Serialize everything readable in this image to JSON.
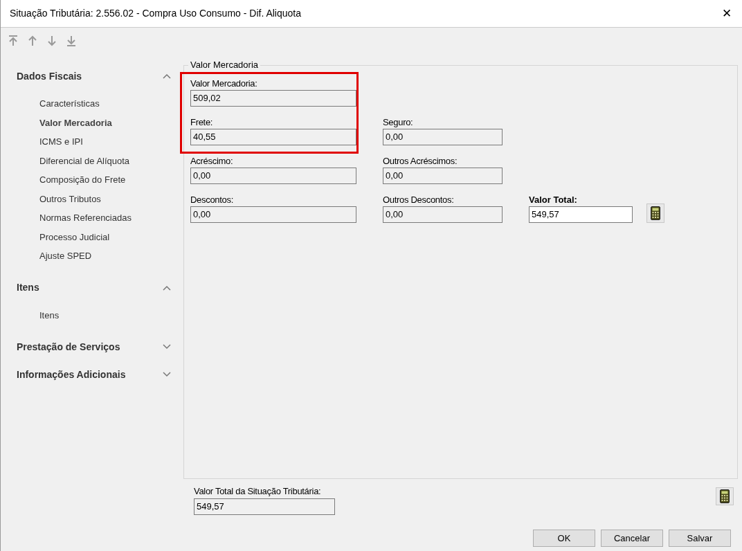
{
  "window": {
    "title": "Situação Tributária: 2.556.02 - Compra Uso Consumo - Dif. Aliquota",
    "close": "✕"
  },
  "toolbar": [
    {
      "kind": "first"
    },
    {
      "kind": "up"
    },
    {
      "kind": "down"
    },
    {
      "kind": "last"
    }
  ],
  "sidebar": {
    "sections": [
      {
        "title": "Dados Fiscais",
        "expanded": true,
        "items": [
          {
            "label": "Características",
            "selected": false
          },
          {
            "label": "Valor Mercadoria",
            "selected": true
          },
          {
            "label": "ICMS e IPI",
            "selected": false
          },
          {
            "label": "Diferencial de Alíquota",
            "selected": false
          },
          {
            "label": "Composição do Frete",
            "selected": false
          },
          {
            "label": "Outros Tributos",
            "selected": false
          },
          {
            "label": "Normas Referenciadas",
            "selected": false
          },
          {
            "label": "Processo Judicial",
            "selected": false
          },
          {
            "label": "Ajuste SPED",
            "selected": false
          }
        ]
      },
      {
        "title": "Itens",
        "expanded": true,
        "items": [
          {
            "label": "Itens",
            "selected": false
          }
        ]
      },
      {
        "title": "Prestação de Serviços",
        "expanded": false
      },
      {
        "title": "Informações Adicionais",
        "expanded": false
      }
    ]
  },
  "group": {
    "title": "Valor Mercadoria",
    "rows": [
      [
        {
          "label": "Valor Mercadoria:",
          "value": "509,02",
          "highlighted": true
        }
      ],
      [
        {
          "label": "Frete:",
          "value": "40,55",
          "highlighted": true
        },
        {
          "label": "Seguro:",
          "value": "0,00",
          "highlighted": false
        }
      ],
      [
        {
          "label": "Acréscimo:",
          "value": "0,00",
          "highlighted": false
        },
        {
          "label": "Outros Acréscimos:",
          "value": "0,00",
          "highlighted": false
        }
      ],
      [
        {
          "label": "Descontos:",
          "value": "0,00",
          "highlighted": false
        },
        {
          "label": "Outros Descontos:",
          "value": "0,00",
          "highlighted": false
        },
        {
          "label": "Valor Total:",
          "value": "549,57",
          "highlighted": false,
          "kind": "total"
        }
      ]
    ]
  },
  "footer": {
    "label": "Valor Total da Situação Tributária:",
    "value": "549,57"
  },
  "buttons": [
    "OK",
    "Cancelar",
    "Salvar"
  ]
}
